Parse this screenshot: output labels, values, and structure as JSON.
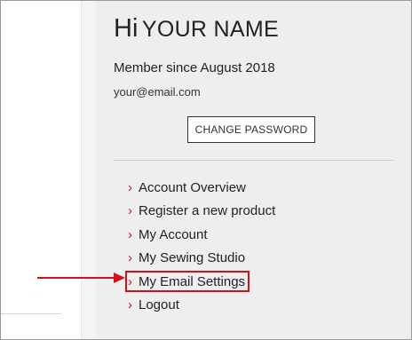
{
  "greeting": {
    "hi": "Hi",
    "name": "YOUR NAME"
  },
  "account": {
    "member_since": "Member since August 2018",
    "email": "your@email.com",
    "change_password_label": "CHANGE PASSWORD"
  },
  "menu": {
    "items": [
      {
        "label": "Account Overview",
        "icon": "chevron-right-icon"
      },
      {
        "label": "Register a new product",
        "icon": "chevron-right-icon"
      },
      {
        "label": "My Account",
        "icon": "chevron-right-icon"
      },
      {
        "label": "My Sewing Studio",
        "icon": "chevron-right-icon"
      },
      {
        "label": "My Email Settings",
        "icon": "chevron-right-icon",
        "highlighted": true
      },
      {
        "label": "Logout",
        "icon": "chevron-right-icon"
      }
    ]
  },
  "annotation": {
    "arrow_icon": "arrow-right-icon",
    "highlight_item": "My Email Settings"
  },
  "colors": {
    "accent": "#d0121b",
    "panel_bg": "#eeeeee",
    "text": "#222222"
  }
}
